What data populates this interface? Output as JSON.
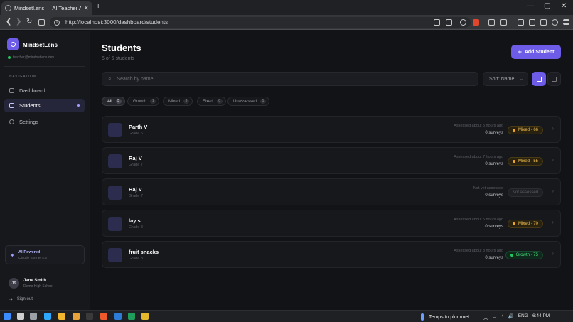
{
  "browser": {
    "tab_title": "Mindsetl.ens — AI Teacher Anal...",
    "close_glyph": "✕",
    "newtab_glyph": "+",
    "url": "http://localhost:3000/dashboard/students",
    "window_controls": [
      "—",
      "▢",
      "✕"
    ],
    "nav_glyphs": [
      "❮",
      "❯",
      "↻"
    ],
    "info_glyph": "i"
  },
  "sidebar": {
    "brand": "MindsetLens",
    "email": "teacher@mindsetlens.dev",
    "nav_header": "NAVIGATION",
    "items": [
      {
        "label": "Dashboard",
        "icon": "home-icon",
        "active": false
      },
      {
        "label": "Students",
        "icon": "users-icon",
        "active": true
      },
      {
        "label": "Settings",
        "icon": "gear-icon",
        "active": false
      }
    ],
    "ai": {
      "icon_glyph": "✦",
      "title": "AI-Powered",
      "model": "Claude Sonnet 4.5"
    },
    "user": {
      "initials": "JS",
      "name": "Jane Smith",
      "school": "Demo High School"
    },
    "signout_glyph": "↦",
    "signout": "Sign out"
  },
  "main": {
    "title": "Students",
    "subtitle": "5 of 5 students",
    "add_glyph": "+",
    "add_button": "Add Student",
    "search_glyph": "⌕",
    "search_placeholder": "Search by name...",
    "sort_label": "Sort: Name",
    "sort_chevron": "⌄",
    "filters": [
      {
        "label": "All",
        "count": "5",
        "active": true
      },
      {
        "label": "Growth",
        "count": "1",
        "active": false
      },
      {
        "label": "Mixed",
        "count": "3",
        "active": false
      },
      {
        "label": "Fixed",
        "count": "0",
        "active": false
      },
      {
        "label": "Unassessed",
        "count": "1",
        "active": false
      }
    ],
    "row_chevron": "›",
    "students": [
      {
        "name": "Parth V",
        "grade": "Grade 6",
        "assessed": "Assessed about 5 hours ago",
        "surveys": "0 surveys",
        "badge": "Mixed · 66",
        "badge_type": "mixed"
      },
      {
        "name": "Raj V",
        "grade": "Grade 7",
        "assessed": "Assessed about 7 hours ago",
        "surveys": "0 surveys",
        "badge": "Mixed · 55",
        "badge_type": "mixed"
      },
      {
        "name": "Raj V",
        "grade": "Grade 7",
        "assessed": "Not yet assessed",
        "surveys": "0 surveys",
        "badge": "Not assessed",
        "badge_type": "none"
      },
      {
        "name": "lay s",
        "grade": "Grade 8",
        "assessed": "Assessed about 5 hours ago",
        "surveys": "0 surveys",
        "badge": "Mixed · 70",
        "badge_type": "mixed"
      },
      {
        "name": "fruit snacks",
        "grade": "Grade 8",
        "assessed": "Assessed about 3 hours ago",
        "surveys": "0 surveys",
        "badge": "Growth · 75",
        "badge_type": "growth"
      }
    ]
  },
  "taskbar": {
    "weather": "Temps to plummet",
    "tray_glyphs": [
      "︿",
      "▭",
      "◔",
      "🔊"
    ],
    "language": "ENG",
    "time": "6:44 PM",
    "icon_colors": [
      "#3b8cff",
      "#cfcfcf",
      "#9aa0a6",
      "#2ea8ff",
      "#f2b62f",
      "#e8a23a",
      "#3a3a3a",
      "#ef5a2a",
      "#2c7bd6",
      "#1e9e5a",
      "#e5b92b",
      "#1565c0"
    ]
  },
  "colors": {
    "accent": "#6c5ce7",
    "mixed": "#f5a524",
    "growth": "#22c55e"
  }
}
